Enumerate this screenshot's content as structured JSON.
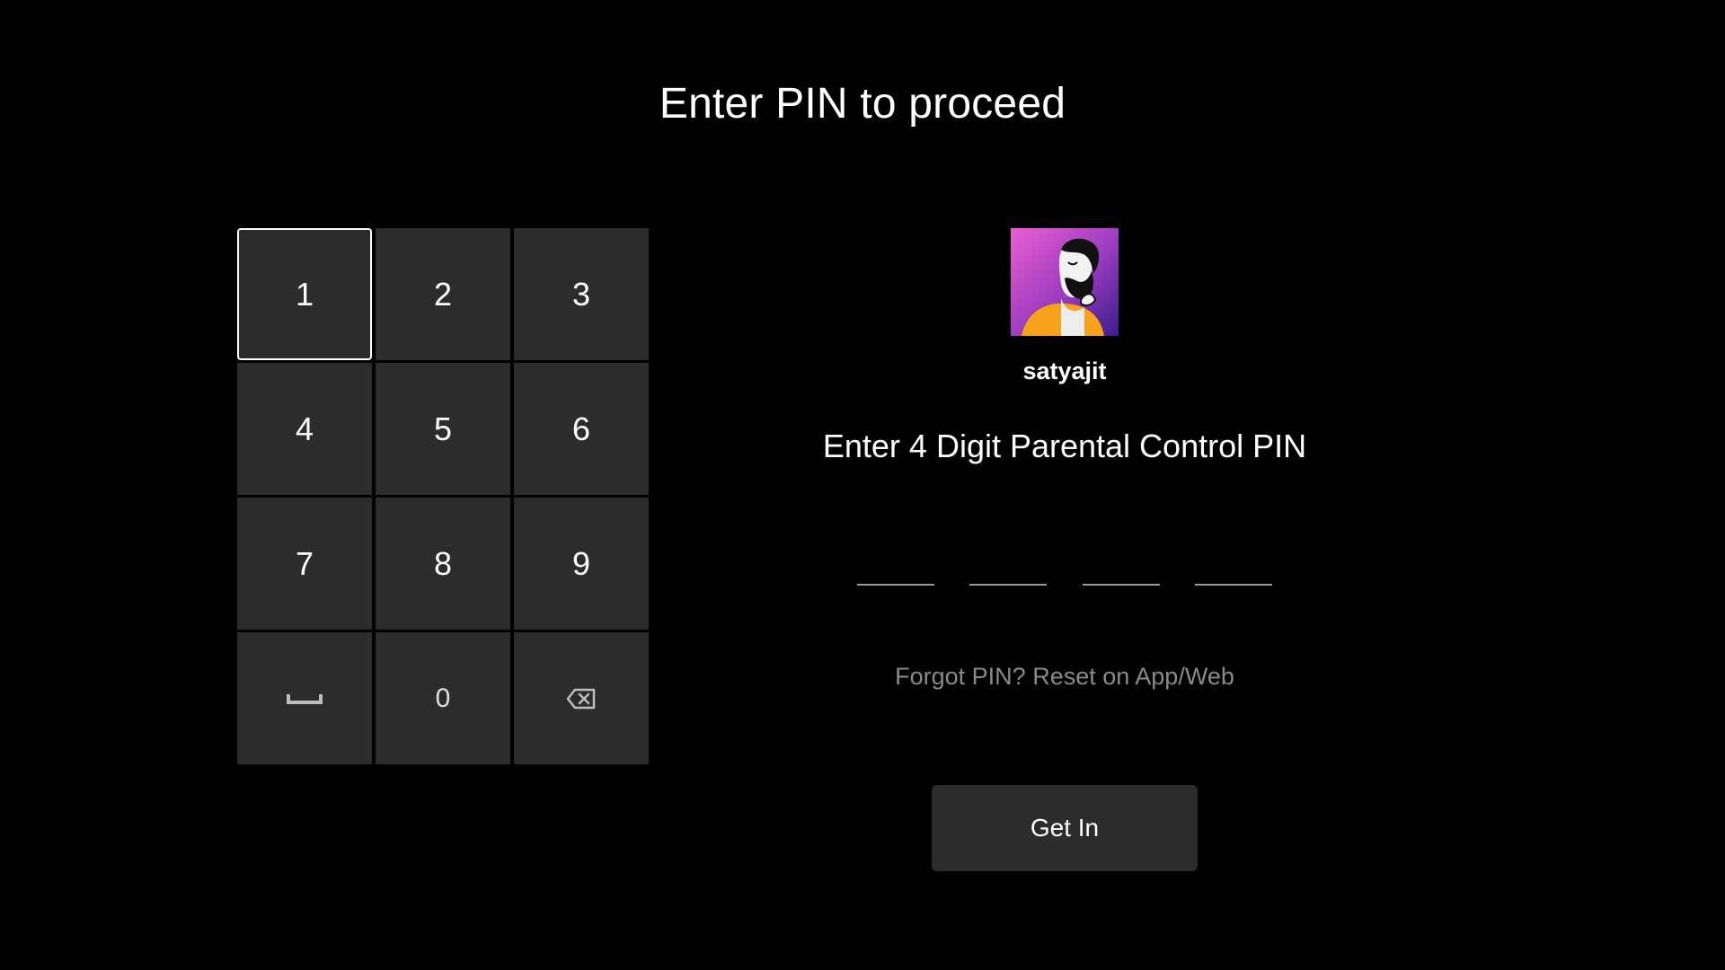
{
  "title": "Enter PIN to proceed",
  "keypad": {
    "keys": [
      {
        "label": "1"
      },
      {
        "label": "2"
      },
      {
        "label": "3"
      },
      {
        "label": "4"
      },
      {
        "label": "5"
      },
      {
        "label": "6"
      },
      {
        "label": "7"
      },
      {
        "label": "8"
      },
      {
        "label": "9"
      },
      {
        "icon": "space-icon"
      },
      {
        "label": "0"
      },
      {
        "icon": "backspace-icon"
      }
    ],
    "focused_key": "1"
  },
  "profile": {
    "username": "satyajit",
    "avatar_icon": "bearded-man-avatar"
  },
  "pin": {
    "prompt": "Enter 4 Digit Parental Control PIN",
    "digits_entered": 0,
    "slots": 4
  },
  "forgot_text": "Forgot PIN? Reset on App/Web",
  "submit_label": "Get In",
  "colors": {
    "background": "#000000",
    "key_bg": "#2c2c2c",
    "muted_text": "#8a8a8a",
    "avatar_gradient_start": "#e85ac8",
    "avatar_gradient_end": "#3a1e8c",
    "avatar_shirt": "#f7a21b"
  }
}
